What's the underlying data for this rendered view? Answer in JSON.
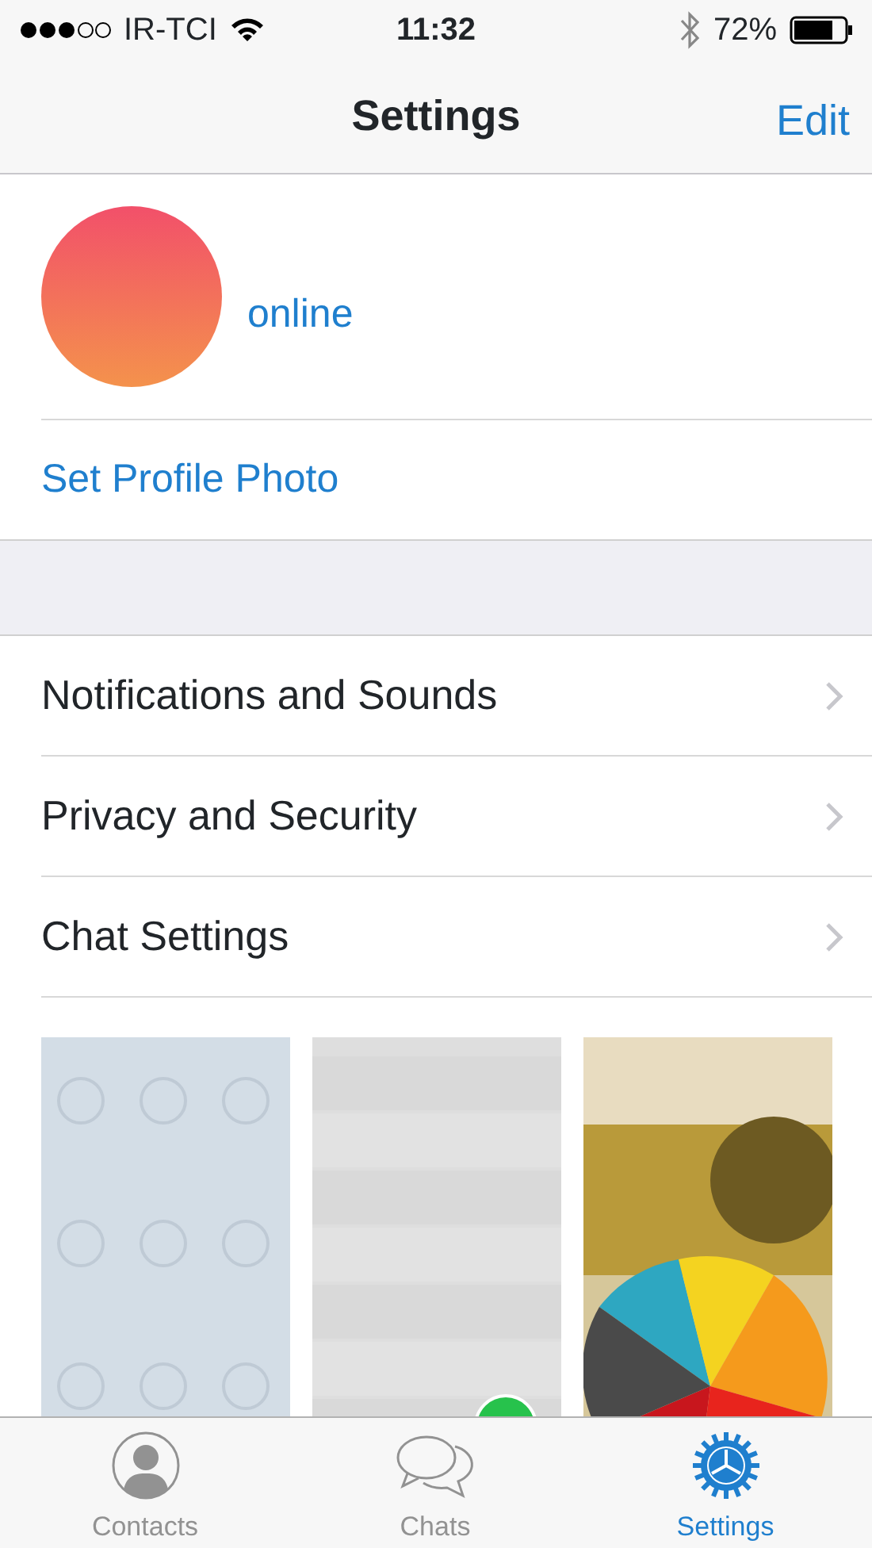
{
  "status_bar": {
    "carrier": "IR-TCI",
    "time": "11:32",
    "battery": "72%"
  },
  "nav": {
    "title": "Settings",
    "action": "Edit"
  },
  "profile": {
    "status": "online",
    "set_photo": "Set Profile Photo"
  },
  "menu": [
    {
      "label": "Notifications and Sounds"
    },
    {
      "label": "Privacy and Security"
    },
    {
      "label": "Chat Settings"
    }
  ],
  "wallpapers": [
    {
      "kind": "pattern",
      "selected": false
    },
    {
      "kind": "wood",
      "selected": true
    },
    {
      "kind": "picture",
      "selected": false
    }
  ],
  "tabs": [
    {
      "label": "Contacts",
      "kind": "contacts",
      "selected": false
    },
    {
      "label": "Chats",
      "kind": "chats",
      "selected": false
    },
    {
      "label": "Settings",
      "kind": "settings",
      "selected": true
    }
  ]
}
